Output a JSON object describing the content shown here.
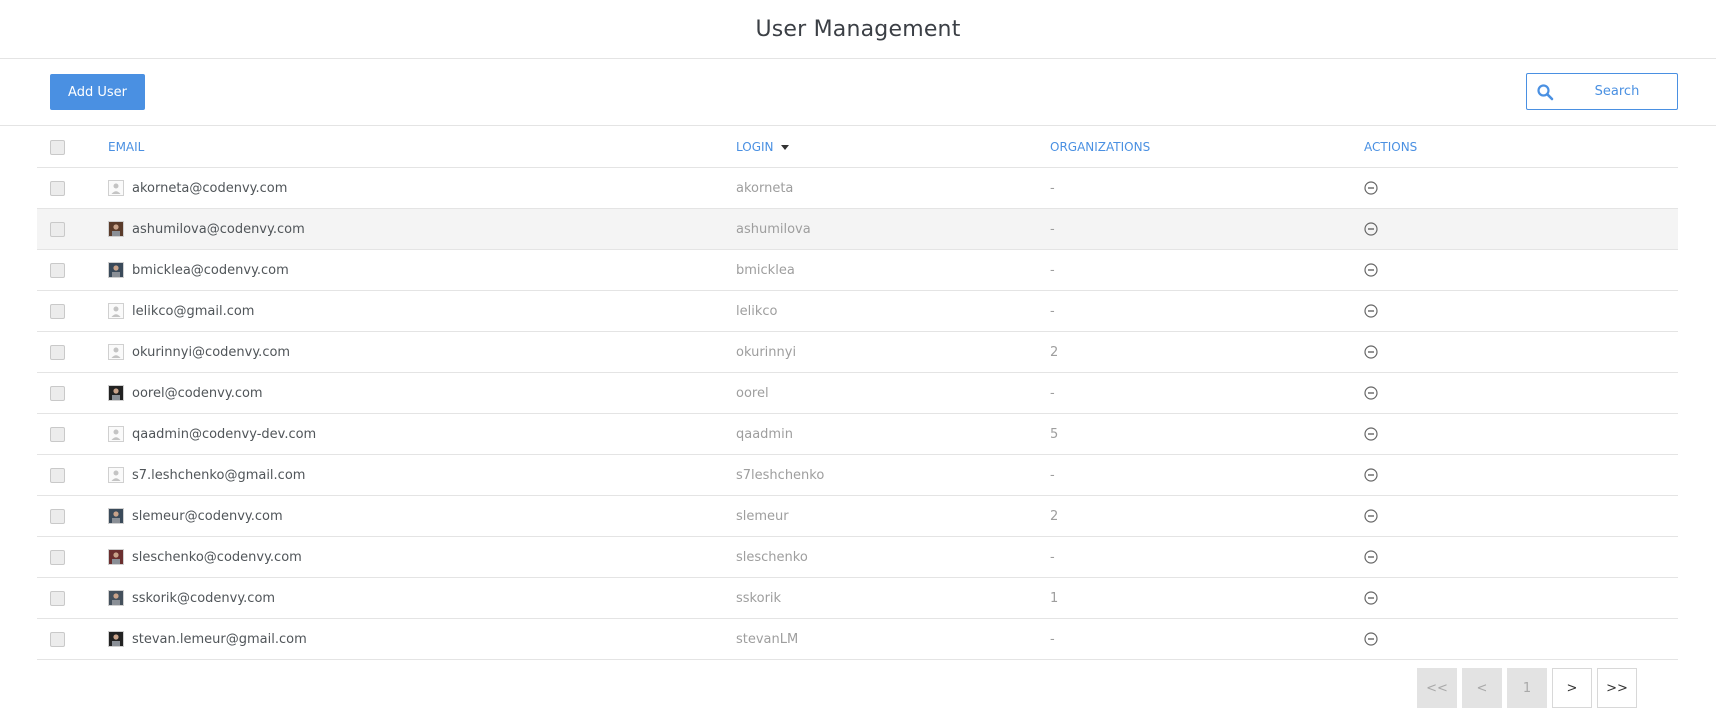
{
  "header": {
    "title": "User Management"
  },
  "toolbar": {
    "add_user_label": "Add User",
    "search_placeholder": "Search"
  },
  "table": {
    "columns": {
      "email": "EMAIL",
      "login": "LOGIN",
      "organizations": "ORGANIZATIONS",
      "actions": "ACTIONS"
    },
    "sorted_by": "login",
    "rows": [
      {
        "email": "akorneta@codenvy.com",
        "login": "akorneta",
        "organizations": "-",
        "avatar": "default"
      },
      {
        "email": "ashumilova@codenvy.com",
        "login": "ashumilova",
        "organizations": "-",
        "avatar": "photo"
      },
      {
        "email": "bmicklea@codenvy.com",
        "login": "bmicklea",
        "organizations": "-",
        "avatar": "photo"
      },
      {
        "email": "lelikco@gmail.com",
        "login": "lelikco",
        "organizations": "-",
        "avatar": "default"
      },
      {
        "email": "okurinnyi@codenvy.com",
        "login": "okurinnyi",
        "organizations": "2",
        "avatar": "default"
      },
      {
        "email": "oorel@codenvy.com",
        "login": "oorel",
        "organizations": "-",
        "avatar": "photo"
      },
      {
        "email": "qaadmin@codenvy-dev.com",
        "login": "qaadmin",
        "organizations": "5",
        "avatar": "default"
      },
      {
        "email": "s7.leshchenko@gmail.com",
        "login": "s7leshchenko",
        "organizations": "-",
        "avatar": "default"
      },
      {
        "email": "slemeur@codenvy.com",
        "login": "slemeur",
        "organizations": "2",
        "avatar": "photo"
      },
      {
        "email": "sleschenko@codenvy.com",
        "login": "sleschenko",
        "organizations": "-",
        "avatar": "photo"
      },
      {
        "email": "sskorik@codenvy.com",
        "login": "sskorik",
        "organizations": "1",
        "avatar": "photo"
      },
      {
        "email": "stevan.lemeur@gmail.com",
        "login": "stevanLM",
        "organizations": "-",
        "avatar": "photo"
      }
    ]
  },
  "pagination": {
    "first": "<<",
    "prev": "<",
    "current": "1",
    "next": ">",
    "last": ">>"
  },
  "colors": {
    "accent": "#4a90e2",
    "border": "#e4e4e4"
  }
}
